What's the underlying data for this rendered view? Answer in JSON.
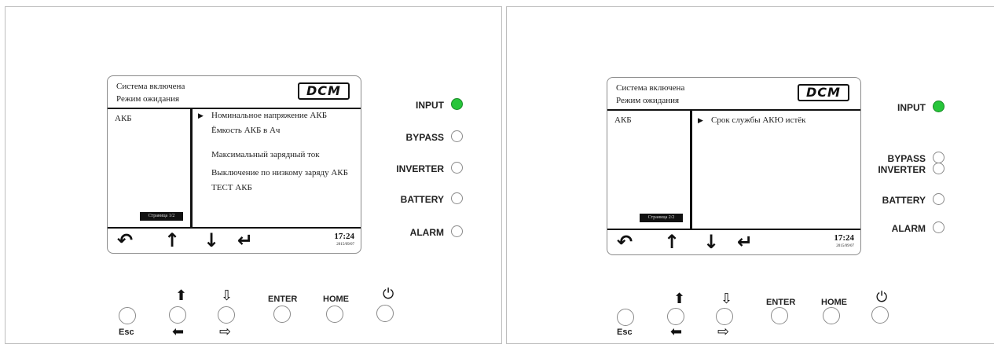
{
  "panels": [
    {
      "screen": {
        "status_line_1": "Система включена",
        "status_line_2": "Режим ожидания",
        "logo_text": "DCM",
        "left_label": "АКБ",
        "page_indicator": "Страница 1/2",
        "menu_items": [
          {
            "label": "Номинальное напряжение АКБ",
            "selected": true
          },
          {
            "label": "Ёмкость АКБ в Ач",
            "selected": false
          },
          {
            "label": "Максимальный зарядный ток",
            "selected": false
          },
          {
            "label": "Выключение по низкому заряду АКБ",
            "selected": false
          },
          {
            "label": "ТЕСТ АКБ",
            "selected": false
          }
        ],
        "nav_icons": [
          "back-icon",
          "up-arrow-icon",
          "down-arrow-icon",
          "enter-icon"
        ],
        "time": "17:24",
        "date": "2015/09/07"
      }
    },
    {
      "screen": {
        "status_line_1": "Система включена",
        "status_line_2": "Режим ожидания",
        "logo_text": "DCM",
        "left_label": "АКБ",
        "page_indicator": "Страница 2/2",
        "menu_items": [
          {
            "label": "Срок службы АКЮ истёк",
            "selected": true
          }
        ],
        "nav_icons": [
          "back-icon",
          "up-arrow-icon",
          "down-arrow-icon",
          "enter-icon"
        ],
        "time": "17:24",
        "date": "2015/09/07"
      }
    }
  ],
  "leds": [
    {
      "label": "INPUT",
      "state": "on",
      "color": "#27c53a"
    },
    {
      "label": "BYPASS",
      "state": "off"
    },
    {
      "label": "INVERTER",
      "state": "off"
    },
    {
      "label": "BATTERY",
      "state": "off"
    },
    {
      "label": "ALARM",
      "state": "off"
    }
  ],
  "buttons": {
    "esc_label": "Esc",
    "enter_label": "ENTER",
    "home_label": "HOME",
    "icons": {
      "up": "up-arrow-icon",
      "left": "left-arrow-icon",
      "down": "down-arrow-icon",
      "right": "right-arrow-icon",
      "power": "power-icon"
    }
  }
}
